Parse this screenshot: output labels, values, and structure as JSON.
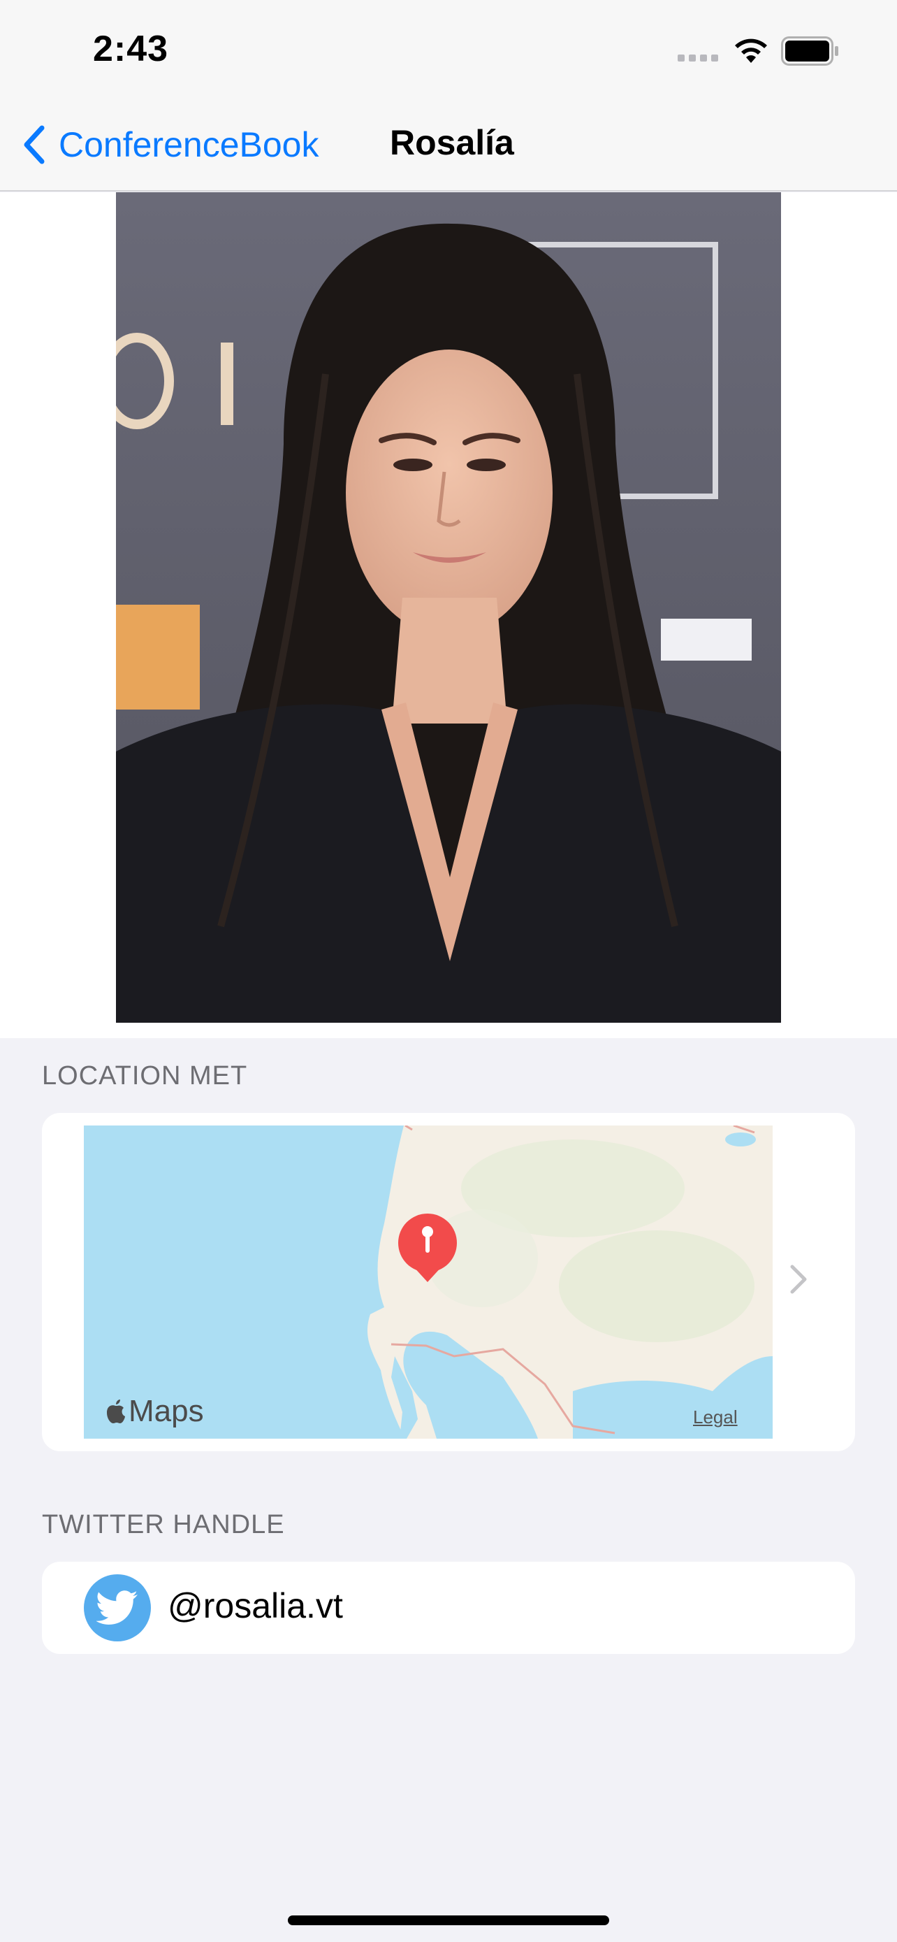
{
  "status_bar": {
    "time": "2:43"
  },
  "nav": {
    "back_label": "ConferenceBook",
    "title": "Rosalía"
  },
  "location_section": {
    "header": "LOCATION MET"
  },
  "map": {
    "brand_label": "Maps",
    "legal_label": "Legal"
  },
  "twitter_section": {
    "header": "TWITTER HANDLE",
    "handle": "@rosalia.vt"
  },
  "colors": {
    "accent": "#0a7aff",
    "pin": "#f24b4b",
    "twitter": "#55acee"
  }
}
